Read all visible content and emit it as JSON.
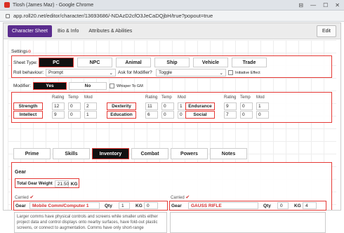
{
  "window": {
    "title": "Tlosh (James Maz) - Google Chrome",
    "url": "app.roll20.net/editor/character/13693686/-NDAzD2cfO3JeCaDQjbH/true?popout=true"
  },
  "topnav": {
    "tabs": [
      "Character Sheet",
      "Bio & Info",
      "Attributes & Abilities"
    ],
    "edit": "Edit"
  },
  "settings": {
    "label": "Settings",
    "required_mark": "⊖"
  },
  "sheet_type": {
    "label": "Sheet Type:",
    "options": [
      "PC",
      "NPC",
      "Animal",
      "Ship",
      "Vehicle",
      "Trade"
    ],
    "active": "PC"
  },
  "roll": {
    "label": "Roll behaviour:",
    "value": "Prompt",
    "modifier_label": "Ask for Modifier?",
    "modifier_value": "Toggle",
    "initiative_label": "Initiative Effect"
  },
  "modifier": {
    "label": "Modifier:",
    "yes": "Yes",
    "no": "No",
    "whisper": "Whisper To GM"
  },
  "stats_headers": [
    "Rating",
    "Temp",
    "Mod"
  ],
  "stats": [
    {
      "name": "Strength",
      "rating": "12",
      "temp": "0",
      "mod": "2"
    },
    {
      "name": "Dexterity",
      "rating": "11",
      "temp": "0",
      "mod": "1"
    },
    {
      "name": "Endurance",
      "rating": "9",
      "temp": "0",
      "mod": "1"
    },
    {
      "name": "Intellect",
      "rating": "9",
      "temp": "0",
      "mod": "1"
    },
    {
      "name": "Education",
      "rating": "6",
      "temp": "0",
      "mod": "0"
    },
    {
      "name": "Social",
      "rating": "7",
      "temp": "0",
      "mod": "0"
    }
  ],
  "subtabs": {
    "items": [
      "Prime",
      "Skills",
      "Inventory",
      "Combat",
      "Powers",
      "Notes"
    ],
    "active": "Inventory"
  },
  "gear": {
    "title": "Gear",
    "total_label": "Total Gear Weight",
    "total_value": "21.50",
    "total_unit": "KG",
    "items": [
      {
        "carried_label": "Carried",
        "gear_label": "Gear",
        "name": "Mobile Comm/Computer 1",
        "qty_label": "Qty",
        "qty": "1",
        "kg_label": "KG",
        "kg": "0",
        "description": "Larger comms have physical controls and screens while smaller units either project data and control displays onto nearby surfaces, have fold-out plastic screens, or connect to augmentation. Comms have only short-range"
      },
      {
        "carried_label": "Carried",
        "gear_label": "Gear",
        "name": "GAUSS RIFLE",
        "qty_label": "Qty",
        "qty": "0",
        "kg_label": "KG",
        "kg": "4",
        "description": ""
      }
    ]
  }
}
